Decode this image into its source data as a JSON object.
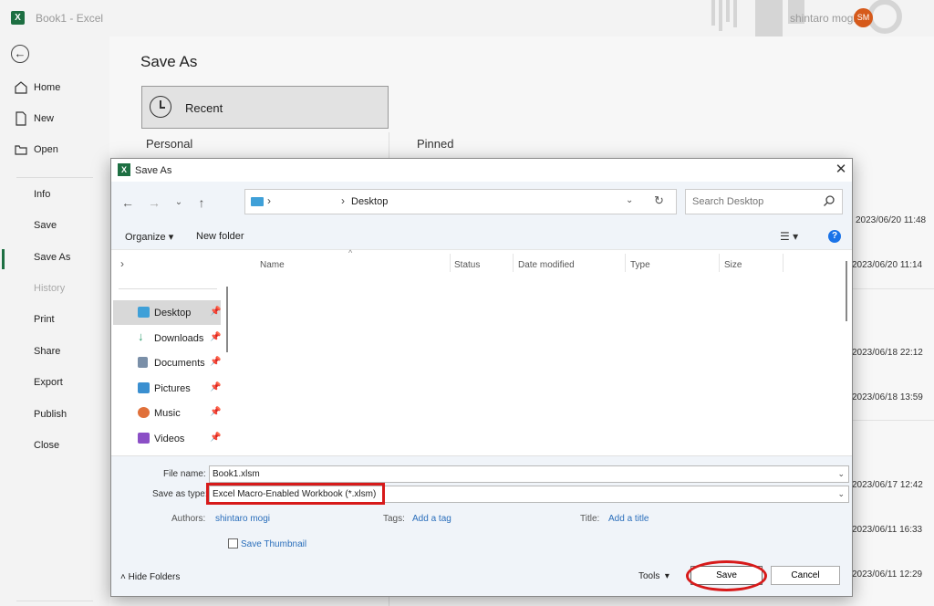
{
  "window": {
    "app_title": "Book1  -  Excel",
    "user_name": "shintaro mogi",
    "user_initials": "SM"
  },
  "nav": {
    "home": "Home",
    "new": "New",
    "open": "Open",
    "info": "Info",
    "save": "Save",
    "save_as": "Save As",
    "history": "History",
    "print": "Print",
    "share": "Share",
    "export": "Export",
    "publish": "Publish",
    "close": "Close"
  },
  "backstage": {
    "title": "Save As",
    "recent_label": "Recent",
    "personal_label": "Personal",
    "pinned_label": "Pinned",
    "dates": [
      "2023/06/20 11:48",
      "2023/06/20 11:14",
      "2023/06/18 22:12",
      "2023/06/18 13:59",
      "2023/06/17 12:42",
      "2023/06/11 16:33",
      "2023/06/11 12:29"
    ]
  },
  "dialog": {
    "title": "Save As",
    "address": "Desktop",
    "search_placeholder": "Search Desktop",
    "organize": "Organize",
    "new_folder": "New folder",
    "quick_access": [
      {
        "label": "Desktop",
        "icon": "desktop-icon",
        "color": "#3fa0d8"
      },
      {
        "label": "Downloads",
        "icon": "download-icon",
        "color": "#2f9e6e"
      },
      {
        "label": "Documents",
        "icon": "documents-icon",
        "color": "#7a8fa8"
      },
      {
        "label": "Pictures",
        "icon": "pictures-icon",
        "color": "#3a8fd0"
      },
      {
        "label": "Music",
        "icon": "music-icon",
        "color": "#e0703a"
      },
      {
        "label": "Videos",
        "icon": "videos-icon",
        "color": "#8b4fc6"
      }
    ],
    "columns": {
      "name": "Name",
      "status": "Status",
      "date_modified": "Date modified",
      "type": "Type",
      "size": "Size"
    },
    "file_name_label": "File name:",
    "file_name_value": "Book1.xlsm",
    "save_type_label": "Save as type:",
    "save_type_value": "Excel Macro-Enabled Workbook (*.xlsm)",
    "authors_label": "Authors:",
    "authors_value": "shintaro mogi",
    "tags_label": "Tags:",
    "tags_value": "Add a tag",
    "title_label": "Title:",
    "title_value": "Add a title",
    "thumbnail_label": "Save Thumbnail",
    "hide_folders": "Hide Folders",
    "tools": "Tools",
    "save_button": "Save",
    "cancel_button": "Cancel"
  },
  "colors": {
    "excel_green": "#1d6f42",
    "highlight_red": "#d71a1a",
    "link_blue": "#2a6ebb"
  }
}
